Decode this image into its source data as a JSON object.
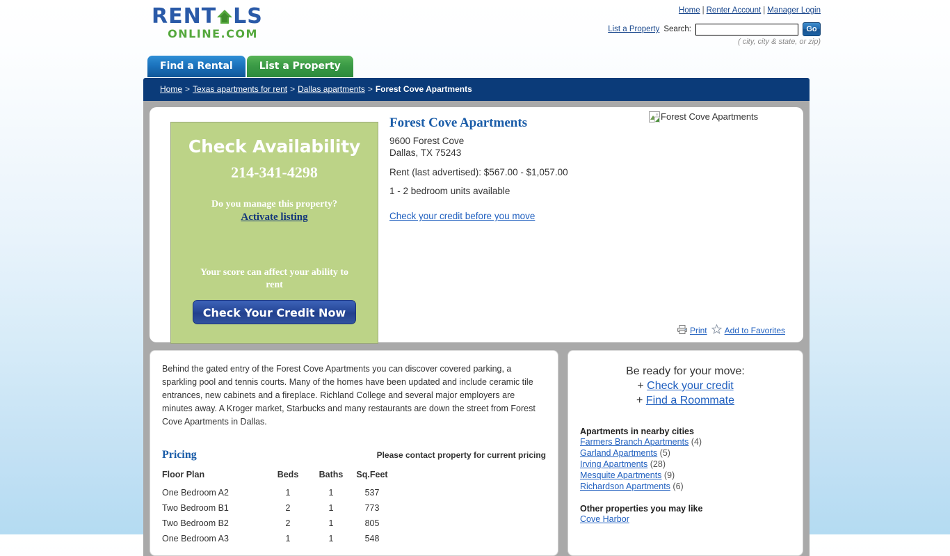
{
  "header": {
    "logo_top_left": "RENT",
    "logo_top_right": "LS",
    "logo_bottom": "ONLINE.COM",
    "nav": [
      {
        "label": "Home"
      },
      {
        "label": "Renter Account"
      },
      {
        "label": "Manager Login"
      }
    ],
    "nav_separator": "|",
    "list_property_link": "List a Property",
    "search_label": "Search:",
    "search_value": "",
    "search_placeholder": "",
    "go_label": "Go",
    "search_hint": "( city, city & state, or zip)"
  },
  "tabs": [
    {
      "label": "Find a Rental",
      "active": true
    },
    {
      "label": "List a Property",
      "active": false
    }
  ],
  "breadcrumb": {
    "items": [
      {
        "label": "Home",
        "link": true
      },
      {
        "label": "Texas apartments for rent",
        "link": true
      },
      {
        "label": "Dallas apartments",
        "link": true
      },
      {
        "label": "Forest Cove Apartments",
        "link": false
      }
    ],
    "separator": ">"
  },
  "promo": {
    "title": "Check Availability",
    "phone": "214-341-4298",
    "manage_question": "Do you manage this property?",
    "activate_link": "Activate listing",
    "score_text": "Your score can affect your ability to rent",
    "credit_button": "Check Your Credit Now"
  },
  "property": {
    "name": "Forest Cove Apartments",
    "address_line1": "9600 Forest Cove",
    "address_line2": "Dallas, TX 75243",
    "rent": "Rent (last advertised): $567.00 - $1,057.00",
    "units": "1 - 2 bedroom units available",
    "credit_link": "Check your credit before you move",
    "photo_alt": "Forest Cove Apartments"
  },
  "tools": {
    "print": "Print",
    "favorites": "Add to Favorites"
  },
  "description": "Behind the gated entry of the Forest Cove Apartments you can discover covered parking, a sparkling pool and tennis courts. Many of the homes have been updated and include ceramic tile entrances, new cabinets and a fireplace. Richland College and several major employers are minutes away. A Kroger market, Starbucks and many restaurants are down the street from Forest Cove Apartments in Dallas.",
  "pricing": {
    "title": "Pricing",
    "note": "Please contact property for current pricing",
    "columns": [
      "Floor Plan",
      "Beds",
      "Baths",
      "Sq.Feet"
    ],
    "rows": [
      {
        "plan": "One Bedroom A2",
        "beds": "1",
        "baths": "1",
        "sqft": "537"
      },
      {
        "plan": "Two Bedroom B1",
        "beds": "2",
        "baths": "1",
        "sqft": "773"
      },
      {
        "plan": "Two Bedroom B2",
        "beds": "2",
        "baths": "1",
        "sqft": "805"
      },
      {
        "plan": "One Bedroom A3",
        "beds": "1",
        "baths": "1",
        "sqft": "548"
      }
    ]
  },
  "sidebar": {
    "ready_title": "Be ready for your move:",
    "ready_items": [
      {
        "bullet": "+",
        "label": "Check your credit"
      },
      {
        "bullet": "+",
        "label": "Find a Roommate"
      }
    ],
    "nearby_title": "Apartments in nearby cities",
    "nearby": [
      {
        "label": "Farmers Branch Apartments",
        "count": "(4)"
      },
      {
        "label": "Garland Apartments",
        "count": "(5)"
      },
      {
        "label": "Irving Apartments",
        "count": "(28)"
      },
      {
        "label": "Mesquite Apartments",
        "count": "(9)"
      },
      {
        "label": "Richardson Apartments",
        "count": "(6)"
      }
    ],
    "other_title": "Other properties you may like",
    "other": [
      {
        "label": "Cove Harbor"
      }
    ]
  }
}
